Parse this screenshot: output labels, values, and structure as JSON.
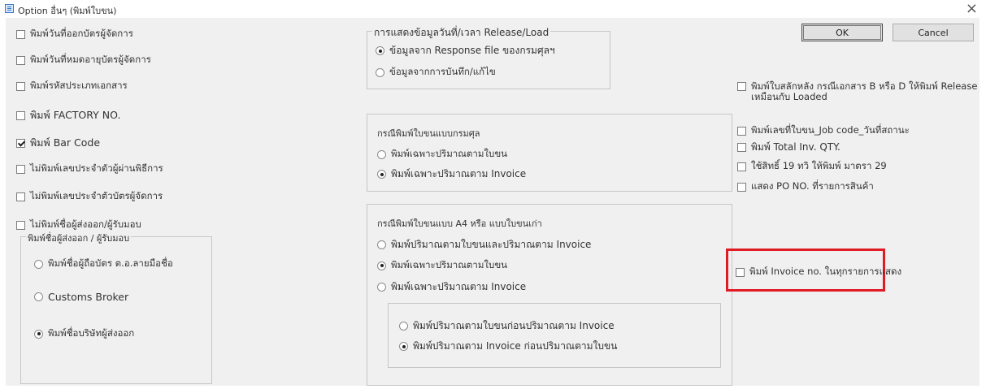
{
  "window": {
    "title": "Option อื่นๆ (พิมพ์ใบขน)",
    "close_glyph": "×"
  },
  "left_checks": [
    {
      "label": "พิมพ์วันที่ออกบัตรผู้จัดการ",
      "checked": false
    },
    {
      "label": "พิมพ์วันที่หมดอายุบัตรผู้จัดการ",
      "checked": false
    },
    {
      "label": "พิมพ์รหัสประเภทเอกสาร",
      "checked": false
    },
    {
      "label": "พิมพ์ FACTORY NO.",
      "checked": false
    },
    {
      "label": "พิมพ์ Bar Code",
      "checked": true
    },
    {
      "label": "ไม่พิมพ์เลขประจำตัวผู้ผ่านพิธีการ",
      "checked": false
    },
    {
      "label": "ไม่พิมพ์เลขประจำตัวบัตรผู้จัดการ",
      "checked": false
    },
    {
      "label": "ไม่พิมพ์ชื่อผู้ส่งออก/ผู้รับมอบ",
      "checked": false
    }
  ],
  "exporter_group": {
    "title": "พิมพ์ชื่อผู้ส่งออก / ผู้รับมอบ",
    "options": [
      {
        "label": "พิมพ์ชื่อผู้ถือบัตร ต.อ.ลายมือชื่อ",
        "selected": false
      },
      {
        "label": "Customs Broker",
        "selected": false
      },
      {
        "label": "พิมพ์ชื่อบริษัทผู้ส่งออก",
        "selected": true
      }
    ]
  },
  "release_group": {
    "title": "การแสดงข้อมูลวันที่/เวลา Release/Load",
    "options": [
      {
        "label": "ข้อมูลจาก Response file ของกรมศุลฯ",
        "selected": true
      },
      {
        "label": "ข้อมูลจากการบันทึก/แก้ไข",
        "selected": false
      }
    ]
  },
  "customs_form_group": {
    "title": "กรณีพิมพ์ใบขนแบบกรมศุล",
    "options": [
      {
        "label": "พิมพ์เฉพาะปริมาณตามใบขน",
        "selected": false
      },
      {
        "label": "พิมพ์เฉพาะปริมาณตาม Invoice",
        "selected": true
      }
    ]
  },
  "a4_group": {
    "title": "กรณีพิมพ์ใบขนแบบ A4 หรือ แบบใบขนเก่า",
    "options": [
      {
        "label": "พิมพ์ปริมาณตามใบขนและปริมาณตาม Invoice",
        "selected": true
      },
      {
        "label": "พิมพ์เฉพาะปริมาณตามใบขน",
        "selected": true
      },
      {
        "label": "พิมพ์เฉพาะปริมาณตาม Invoice",
        "selected": false
      }
    ],
    "order_options": [
      {
        "label": "พิมพ์ปริมาณตามใบขนก่อนปริมาณตาม Invoice",
        "selected": false
      },
      {
        "label": "พิมพ์ปริมาณตาม Invoice ก่อนปริมาณตามใบขน",
        "selected": true
      }
    ]
  },
  "buttons": {
    "ok": "OK",
    "cancel": "Cancel"
  },
  "right_checks": [
    {
      "label": "พิมพ์ใบสลักหลัง กรณีเอกสาร B หรือ D ให้พิมพ์ Release เหมือนกับ Loaded",
      "checked": false
    },
    {
      "label": "พิมพ์เลขที่ใบขน_Job code_วันที่สถานะ",
      "checked": false
    },
    {
      "label": "พิมพ์ Total Inv. QTY.",
      "checked": false
    },
    {
      "label": "ใช้สิทธิ์ 19 ทวิ ให้พิมพ์ มาตรา 29",
      "checked": false
    },
    {
      "label": "แสดง PO NO. ที่รายการสินค้า",
      "checked": false
    },
    {
      "label": "พิมพ์ Invoice no. ในทุกรายการแสดง",
      "checked": false
    }
  ],
  "colors": {
    "highlight": "#e01b24",
    "dialog_bg": "#f0f0f0"
  }
}
